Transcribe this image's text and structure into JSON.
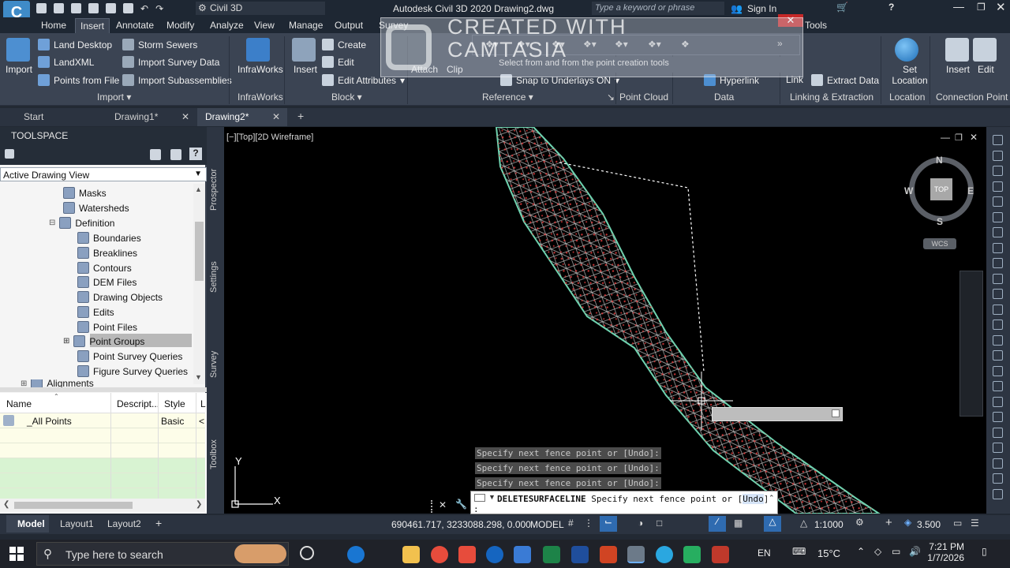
{
  "titlebar": {
    "app_name": "Civil 3D",
    "title": "Autodesk Civil 3D 2020  Drawing2.dwg",
    "search_placeholder": "Type a keyword or phrase",
    "signin": "Sign In"
  },
  "ribbon_tabs": [
    "Home",
    "Insert",
    "Annotate",
    "Modify",
    "Analyze",
    "View",
    "Manage",
    "Output",
    "Survey",
    "Tools"
  ],
  "ribbon": {
    "import_label": "Import",
    "land_desktop": "Land Desktop",
    "landxml": "LandXML",
    "points_from_file": "Points from File",
    "storm_sewers": "Storm Sewers",
    "import_survey_data": "Import Survey Data",
    "import_subassemblies": "Import Subassemblies",
    "infraworks": "InfraWorks",
    "insert": "Insert",
    "create": "Create",
    "edit": "Edit",
    "edit_attributes": "Edit Attributes",
    "attach": "Attach",
    "clip": "Clip",
    "snap_to_underlays": "Snap to Underlays ON",
    "hyperlink": "Hyperlink",
    "link": "Link",
    "extract_data": "Extract  Data",
    "set_location": "Set Location",
    "insert2": "Insert",
    "edit2": "Edit",
    "panels": {
      "import": "Import",
      "infraworks": "InfraWorks",
      "block": "Block",
      "reference": "Reference",
      "point_cloud": "Point Cloud",
      "data": "Data",
      "linking": "Linking & Extraction",
      "location": "Location",
      "connection_point": "Connection Point"
    }
  },
  "overlay": {
    "tooltip": "Select from and from the point creation tools",
    "watermark_line1": "CREATED WITH",
    "watermark_line2": "CAMTASIA"
  },
  "doc_tabs": [
    "Start",
    "Drawing1*",
    "Drawing2*"
  ],
  "toolspace": {
    "title": "TOOLSPACE",
    "view_selector": "Active Drawing View",
    "side_tabs": [
      "Prospector",
      "Settings",
      "Survey",
      "Toolbox"
    ],
    "tree": [
      "Masks",
      "Watersheds",
      "Definition",
      "Boundaries",
      "Breaklines",
      "Contours",
      "DEM Files",
      "Drawing Objects",
      "Edits",
      "Point Files",
      "Point Groups",
      "Point Survey Queries",
      "Figure Survey Queries",
      "Alignments"
    ],
    "grid_columns": [
      "Name",
      "Descript...",
      "Style",
      "L"
    ],
    "grid_rows": [
      {
        "name": "_All Points",
        "style": "Basic",
        "l": "<"
      }
    ]
  },
  "viewport": {
    "view_label": "[−][Top][2D Wireframe]",
    "compass": {
      "n": "N",
      "s": "S",
      "e": "E",
      "w": "W",
      "top": "TOP"
    },
    "wcs": "WCS",
    "axis_y": "Y",
    "axis_x": "X"
  },
  "command": {
    "history": [
      "Specify next fence point or [Undo]:",
      "Specify next fence point or [Undo]:",
      "Specify next fence point or [Undo]:"
    ],
    "current_cmd": "DELETESURFACELINE",
    "current_prompt": "Specify next fence point or [",
    "undo": "Undo",
    "close_bracket": "]",
    "next_line": ":"
  },
  "layout_tabs": [
    "Model",
    "Layout1",
    "Layout2"
  ],
  "status": {
    "coords": "690461.717, 3233088.298, 0.000",
    "model": "MODEL",
    "scale": "1:1000",
    "value": "3.500"
  },
  "taskbar": {
    "search_placeholder": "Type here to search",
    "lang": "EN",
    "temp": "15°C",
    "time": "7:21 PM",
    "date": "1/7/2026"
  }
}
